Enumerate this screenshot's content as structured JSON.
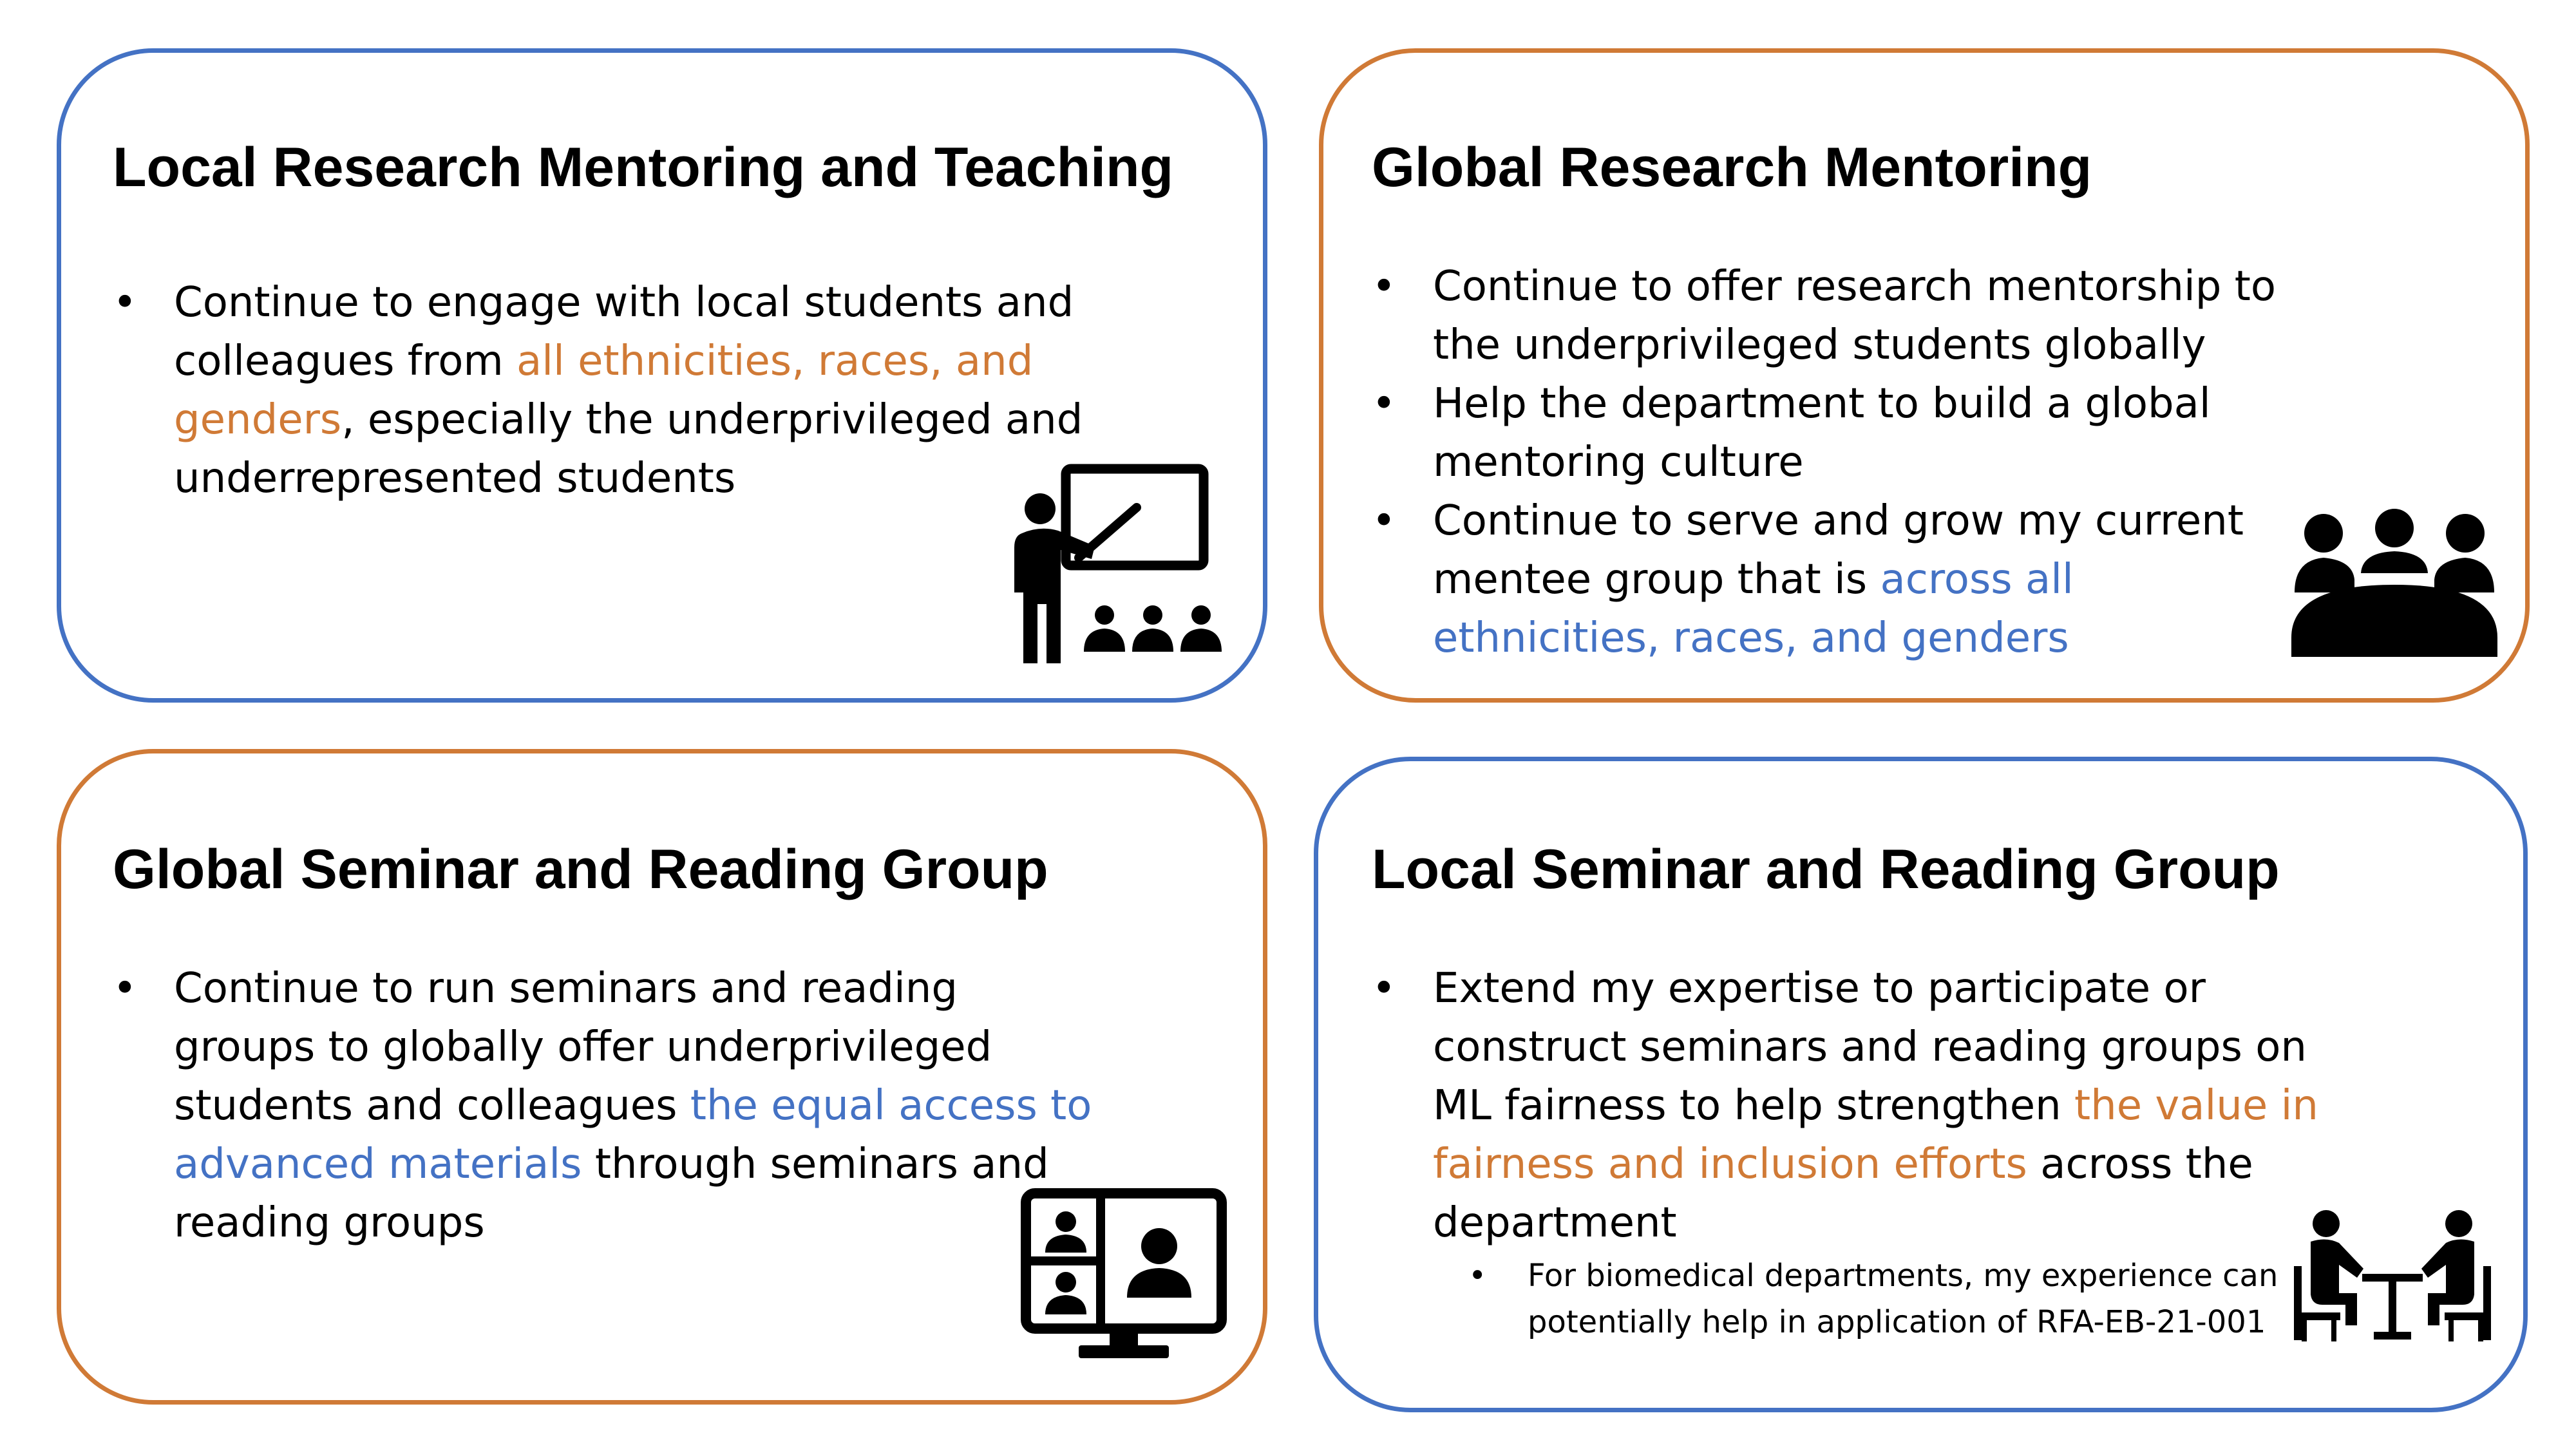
{
  "colors": {
    "blue": "#4472C4",
    "orange": "#D07A36",
    "text": "#000000"
  },
  "cards": [
    {
      "title": "Local Research Mentoring and Teaching",
      "icon": "teacher-presenting-icon",
      "bullets": [
        {
          "before": "Continue to engage with local students and colleagues from ",
          "highlight": "all ethnicities, races, and genders",
          "after": ", especially the underprivileged and underrepresented students"
        }
      ]
    },
    {
      "title": "Global Research Mentoring",
      "icon": "group-meeting-icon",
      "bullets": [
        {
          "text": "Continue to offer research mentorship to the underprivileged students globally"
        },
        {
          "text": "Help the department to build a global mentoring culture"
        },
        {
          "before": "Continue to serve and grow my current mentee group that is ",
          "highlight": "across all ethnicities, races, and genders",
          "after": ""
        }
      ]
    },
    {
      "title": "Global Seminar and Reading Group",
      "icon": "video-conference-icon",
      "bullets": [
        {
          "before": "Continue to run seminars and reading groups to globally offer underprivileged students and colleagues ",
          "highlight": "the equal access to advanced materials",
          "after": " through seminars and reading groups"
        }
      ]
    },
    {
      "title": "Local Seminar and Reading Group",
      "icon": "people-at-table-icon",
      "bullets": [
        {
          "before": "Extend my expertise to participate or construct seminars and reading groups on ML fairness to help strengthen ",
          "highlight": "the value in fairness and inclusion efforts",
          "after": " across the department"
        }
      ],
      "sub_bullet": "For biomedical departments, my experience can potentially help in application of RFA-EB-21-001"
    }
  ]
}
